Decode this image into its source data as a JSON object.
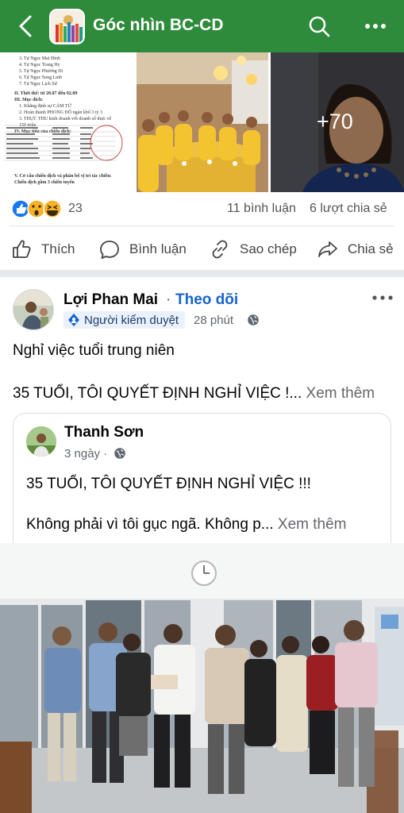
{
  "header": {
    "title": "Góc nhìn BC-CD",
    "back_icon": "arrow-left-icon",
    "search_icon": "search-icon",
    "more_icon": "more-dots-icon",
    "bg_color": "#2e8b3b"
  },
  "previous_post": {
    "doc_lines": [
      "3. Tự Ngọc Mai Đình",
      "4. Tự Ngọc Trang Hy",
      "5. Tự Ngọc Phương Di",
      "6. Tự Ngọc Song Linh",
      "7. Tự Ngọc Lịch Sử"
    ],
    "doc_heading1": "II. Thời thế: từ 20.07 đến 02.09",
    "doc_heading2": "III. Mục đích:",
    "doc_points": [
      "1. Khẳng định sự CẢM TỬ",
      "2. Hoàn thành PHONG ĐỘ ngàn khổ 3 tỷ 3",
      "3. THỰC THU kinh doanh với doanh số thực về",
      "   150 triệu"
    ],
    "doc_heading3": "IV. Mục tiêu của chiến dịch:",
    "doc_heading4": "V. Cơ cấu chiến dịch và phân bổ vị trí tác chiến:",
    "doc_heading5": "Chiến dịch gồm 3 chiến tuyến",
    "more_photos": "+70",
    "reaction_count": "23",
    "comments": "11 bình luận",
    "shares": "6 lượt chia sẻ"
  },
  "actions": {
    "like": "Thích",
    "comment": "Bình luận",
    "copy": "Sao chép",
    "share": "Chia sẻ"
  },
  "post": {
    "author": "Lợi Phan Mai",
    "separator": "·",
    "follow": "Theo dõi",
    "badge": "Người kiểm duyệt",
    "time": "28 phút",
    "line1": "Nghỉ việc tuổi trung niên",
    "line2": "35 TUỔI, TÔI QUYẾT ĐỊNH NGHỈ VIỆC !...",
    "see_more": "Xem thêm",
    "shared": {
      "author": "Thanh Sơn",
      "time": "3 ngày ·",
      "line1": "35 TUỔI, TÔI QUYẾT ĐỊNH NGHỈ VIỆC !!!",
      "line2": "Không phải vì tôi gục ngã. Không p...",
      "see_more": "Xem thêm"
    }
  },
  "colors": {
    "accent_blue": "#1763cf",
    "brand_green": "#2e8b3b"
  }
}
